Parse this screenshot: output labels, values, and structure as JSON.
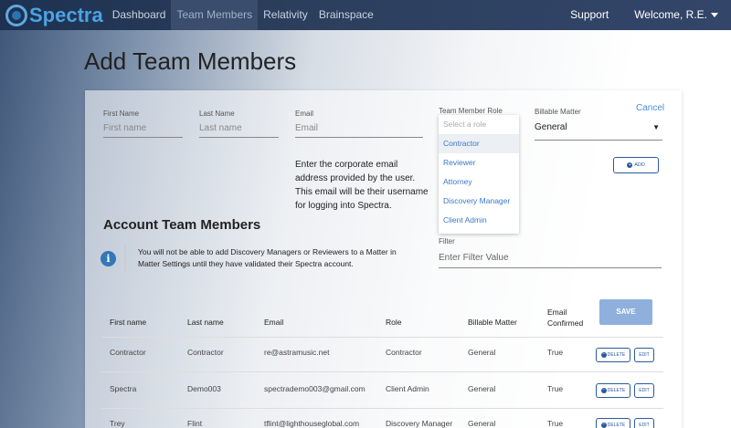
{
  "nav": {
    "brand": "Spectra",
    "links": [
      "Dashboard",
      "Team Members",
      "Relativity",
      "Brainspace"
    ],
    "support": "Support",
    "welcome": "Welcome, R.E."
  },
  "page": {
    "title": "Add Team Members"
  },
  "form": {
    "first_name": {
      "label": "First Name",
      "placeholder": "First name"
    },
    "last_name": {
      "label": "Last Name",
      "placeholder": "Last name"
    },
    "email": {
      "label": "Email",
      "placeholder": "Email",
      "help": "Enter the corporate email address provided by the user. This email will be their username for logging into Spectra."
    },
    "role": {
      "label": "Team Member Role",
      "placeholder": "Select a role",
      "options": [
        "Contractor",
        "Reviewer",
        "Attorney",
        "Discovery Manager",
        "Client Admin"
      ]
    },
    "billable": {
      "label": "Billable Matter",
      "value": "General"
    },
    "cancel": "Cancel",
    "add": "ADD"
  },
  "account": {
    "title": "Account Team Members",
    "info": "You will not be able to add Discovery Managers or Reviewers to a Matter in Matter Settings until they have validated their Spectra account.",
    "filter": {
      "label": "Filter",
      "placeholder": "Enter Filter Value"
    }
  },
  "table": {
    "headers": [
      "First name",
      "Last name",
      "Email",
      "Role",
      "Billable Matter",
      "Email Confirmed"
    ],
    "save": "SAVE",
    "delete": "DELETE",
    "edit": "EDIT",
    "rows": [
      [
        "Contractor",
        "Contractor",
        "re@astramusic.net",
        "Contractor",
        "General",
        "True"
      ],
      [
        "Spectra",
        "Demo003",
        "spectrademo003@gmail.com",
        "Client Admin",
        "General",
        "True"
      ],
      [
        "Trey",
        "Flint",
        "tflint@lighthouseglobal.com",
        "Discovery Manager",
        "General",
        "True"
      ]
    ]
  },
  "colors": {
    "navbar": "#1d3150",
    "brand": "#4aa3e3",
    "accent": "#2b5a9e",
    "link": "#3c78c8",
    "save": "#8fb0dd"
  }
}
